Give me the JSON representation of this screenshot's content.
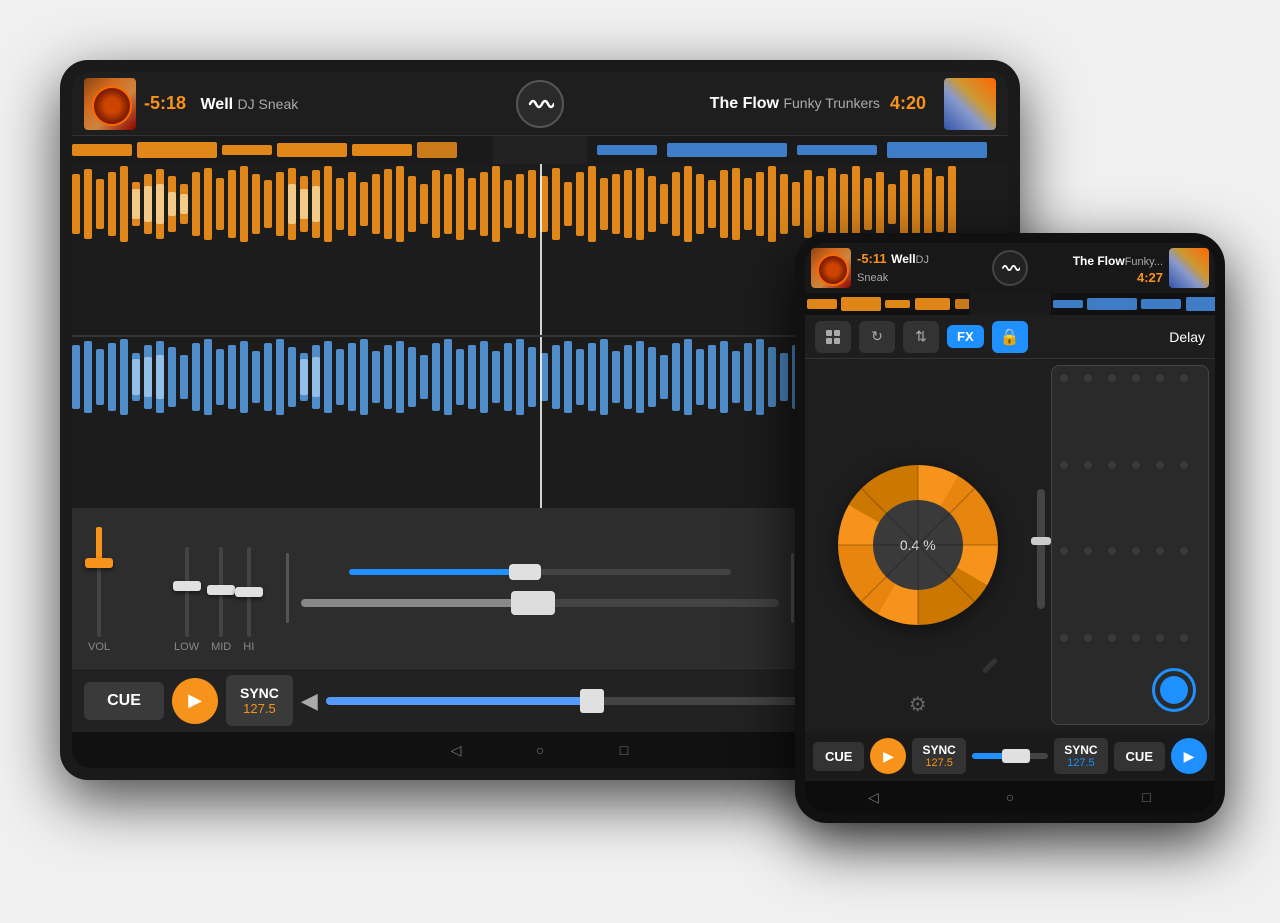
{
  "tablet": {
    "track_left": {
      "time": "-5:18",
      "title": "Well",
      "artist": "DJ Sneak"
    },
    "track_right": {
      "time": "4:20",
      "title": "The Flow",
      "artist": "Funky Trunkers"
    },
    "controls_left": {
      "cue": "CUE",
      "play": "▶",
      "sync_label": "SYNC",
      "sync_bpm": "127.5"
    },
    "faders": {
      "vol_label": "VOL",
      "low_label": "LOW",
      "mid_label": "MID",
      "hi_label": "HI"
    }
  },
  "phone": {
    "track_left": {
      "time": "-5:11",
      "title": "Well",
      "artist": "DJ Sneak"
    },
    "track_right": {
      "time": "4:27",
      "title": "The Flow",
      "artist": "Funky..."
    },
    "turntable": {
      "percent": "0.4 %"
    },
    "fx": {
      "label": "FX",
      "effect": "Delay"
    },
    "controls_left": {
      "cue": "CUE",
      "play": "▶",
      "sync_label": "SYNC",
      "sync_bpm": "127.5"
    },
    "controls_right": {
      "sync_label": "SYNC",
      "sync_bpm": "127.5",
      "cue": "CUE",
      "play": "▶"
    }
  }
}
